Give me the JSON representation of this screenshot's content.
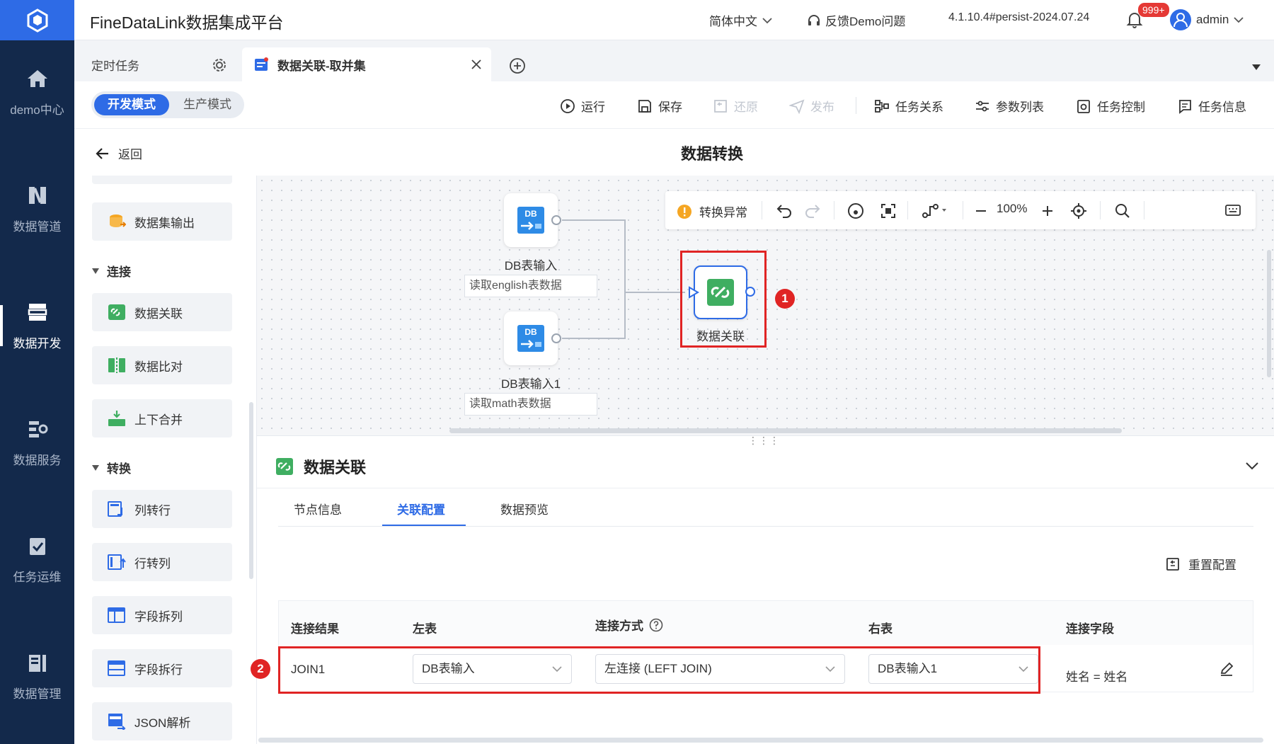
{
  "app": {
    "title": "FineDataLink数据集成平台"
  },
  "nav": [
    {
      "label": "demo中心",
      "icon": "home-icon"
    },
    {
      "label": "数据管道",
      "icon": "pipeline-icon"
    },
    {
      "label": "数据开发",
      "icon": "dev-icon",
      "active": true
    },
    {
      "label": "数据服务",
      "icon": "service-icon"
    },
    {
      "label": "任务运维",
      "icon": "ops-icon"
    },
    {
      "label": "数据管理",
      "icon": "manage-icon"
    }
  ],
  "header": {
    "language": "简体中文",
    "feedback": "反馈Demo问题",
    "version": "4.1.10.4#persist-2024.07.24",
    "notifications": "999+",
    "user": "admin"
  },
  "tabs": [
    {
      "label": "定时任务"
    },
    {
      "label": "数据关联-取并集",
      "active": true
    }
  ],
  "toolbar": {
    "mode_dev": "开发模式",
    "mode_prod": "生产模式",
    "run": "运行",
    "save": "保存",
    "restore": "还原",
    "publish": "发布",
    "task_relation": "任务关系",
    "param_list": "参数列表",
    "task_control": "任务控制",
    "task_info": "任务信息"
  },
  "page": {
    "back": "返回",
    "title": "数据转换"
  },
  "palette": {
    "items_top": [
      {
        "label": "数据集输出"
      }
    ],
    "section_join": "连接",
    "join_items": [
      {
        "label": "数据关联"
      },
      {
        "label": "数据比对"
      },
      {
        "label": "上下合并"
      }
    ],
    "section_transform": "转换",
    "transform_items": [
      {
        "label": "列转行"
      },
      {
        "label": "行转列"
      },
      {
        "label": "字段拆列"
      },
      {
        "label": "字段拆行"
      },
      {
        "label": "JSON解析"
      }
    ]
  },
  "canvas": {
    "status": "转换异常",
    "zoom": "100%",
    "nodes": [
      {
        "label": "DB表输入",
        "desc": "读取english表数据"
      },
      {
        "label": "DB表输入1",
        "desc": "读取math表数据"
      },
      {
        "label": "数据关联"
      }
    ],
    "db_icon_text": "DB"
  },
  "panel": {
    "title": "数据关联",
    "tabs": [
      "节点信息",
      "关联配置",
      "数据预览"
    ],
    "reset": "重置配置",
    "columns": [
      "连接结果",
      "左表",
      "连接方式",
      "右表",
      "连接字段"
    ],
    "row": {
      "result": "JOIN1",
      "left": "DB表输入",
      "join_type": "左连接 (LEFT JOIN)",
      "right": "DB表输入1",
      "fields": "姓名 = 姓名"
    }
  },
  "annotations": [
    "1",
    "2"
  ],
  "colors": {
    "accent": "#2e6be6",
    "nav_bg": "#13294b",
    "highlight": "#e02424",
    "warning": "#f5a623"
  }
}
